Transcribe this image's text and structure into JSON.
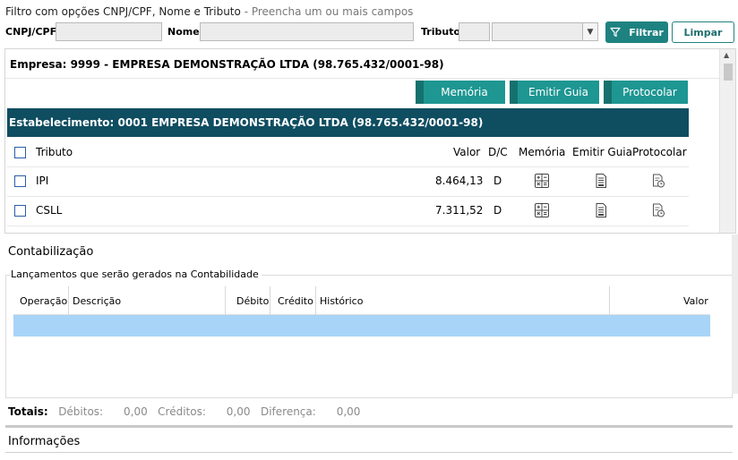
{
  "filter": {
    "hint": "Filtro com opções CNPJ/CPF, Nome e Tributo",
    "hint_sub": "- Preencha um ou mais campos",
    "cnpj_label": "CNPJ/CPF",
    "cnpj_value": "",
    "nome_label": "Nome",
    "nome_value": "",
    "tributo_label": "Tributo",
    "tributo_code": "",
    "tributo_selected": "",
    "filtrar_label": "Filtrar",
    "limpar_label": "Limpar"
  },
  "empresa": {
    "title": "Empresa: 9999 - EMPRESA DEMONSTRAÇÃO LTDA (98.765.432/0001-98)",
    "buttons": {
      "memoria": "Memória",
      "emitir_guia": "Emitir Guia",
      "protocolar": "Protocolar"
    }
  },
  "estabelecimento": {
    "title": "Estabelecimento: 0001 EMPRESA DEMONSTRAÇÃO LTDA (98.765.432/0001-98)",
    "columns": {
      "tributo": "Tributo",
      "valor": "Valor",
      "dc": "D/C",
      "memoria": "Memória",
      "emitir_guia": "Emitir Guia",
      "protocolar": "Protocolar"
    },
    "rows": [
      {
        "tributo": "IPI",
        "valor": "8.464,13",
        "dc": "D"
      },
      {
        "tributo": "CSLL",
        "valor": "7.311,52",
        "dc": "D"
      }
    ]
  },
  "contabilizacao": {
    "title": "Contabilização",
    "group_label": "Lançamentos que serão gerados na Contabilidade",
    "columns": {
      "operacao": "Operação",
      "descricao": "Descrição",
      "debito": "Débito",
      "credito": "Crédito",
      "historico": "Histórico",
      "valor": "Valor"
    }
  },
  "totais": {
    "label": "Totais:",
    "debitos_label": "Débitos:",
    "debitos_value": "0,00",
    "creditos_label": "Créditos:",
    "creditos_value": "0,00",
    "diferenca_label": "Diferença:",
    "diferenca_value": "0,00"
  },
  "informacoes": {
    "title": "Informações"
  },
  "colors": {
    "accent": "#1e8281",
    "header_bar": "#0f4d61",
    "action_button": "#1e9692",
    "selected_row": "#a8d4f7"
  },
  "icons": {
    "filter": "filter-icon",
    "memoria": "calculator-icon",
    "emitir_guia": "document-icon",
    "protocolar": "protocol-document-icon"
  }
}
